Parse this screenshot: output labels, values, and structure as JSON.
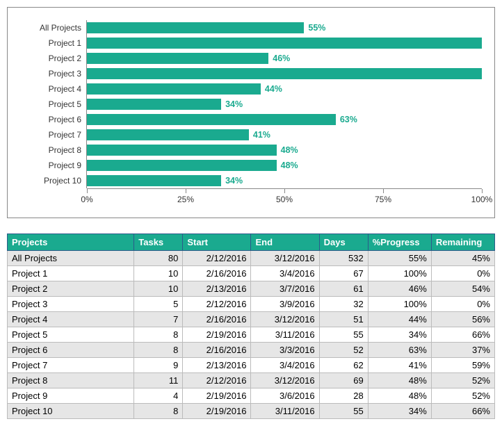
{
  "chart_data": {
    "type": "bar",
    "orientation": "horizontal",
    "categories": [
      "All Projects",
      "Project 1",
      "Project 2",
      "Project 3",
      "Project 4",
      "Project 5",
      "Project 6",
      "Project 7",
      "Project 8",
      "Project 9",
      "Project 10"
    ],
    "values": [
      55,
      100,
      46,
      100,
      44,
      34,
      63,
      41,
      48,
      48,
      34
    ],
    "value_labels": [
      "55%",
      "",
      "46%",
      "",
      "44%",
      "34%",
      "63%",
      "41%",
      "48%",
      "48%",
      "34%"
    ],
    "xlabel": "",
    "ylabel": "",
    "xlim": [
      0,
      100
    ],
    "x_ticks": [
      0,
      25,
      50,
      75,
      100
    ],
    "x_tick_labels": [
      "0%",
      "25%",
      "50%",
      "75%",
      "100%"
    ]
  },
  "table": {
    "headers": [
      "Projects",
      "Tasks",
      "Start",
      "End",
      "Days",
      "%Progress",
      "Remaining"
    ],
    "rows": [
      [
        "All Projects",
        "80",
        "2/12/2016",
        "3/12/2016",
        "532",
        "55%",
        "45%"
      ],
      [
        "Project 1",
        "10",
        "2/16/2016",
        "3/4/2016",
        "67",
        "100%",
        "0%"
      ],
      [
        "Project 2",
        "10",
        "2/13/2016",
        "3/7/2016",
        "61",
        "46%",
        "54%"
      ],
      [
        "Project 3",
        "5",
        "2/12/2016",
        "3/9/2016",
        "32",
        "100%",
        "0%"
      ],
      [
        "Project 4",
        "7",
        "2/16/2016",
        "3/12/2016",
        "51",
        "44%",
        "56%"
      ],
      [
        "Project 5",
        "8",
        "2/19/2016",
        "3/11/2016",
        "55",
        "34%",
        "66%"
      ],
      [
        "Project 6",
        "8",
        "2/16/2016",
        "3/3/2016",
        "52",
        "63%",
        "37%"
      ],
      [
        "Project 7",
        "9",
        "2/13/2016",
        "3/4/2016",
        "62",
        "41%",
        "59%"
      ],
      [
        "Project 8",
        "11",
        "2/12/2016",
        "3/12/2016",
        "69",
        "48%",
        "52%"
      ],
      [
        "Project 9",
        "4",
        "2/19/2016",
        "3/6/2016",
        "28",
        "48%",
        "52%"
      ],
      [
        "Project 10",
        "8",
        "2/19/2016",
        "3/11/2016",
        "55",
        "34%",
        "66%"
      ]
    ]
  }
}
